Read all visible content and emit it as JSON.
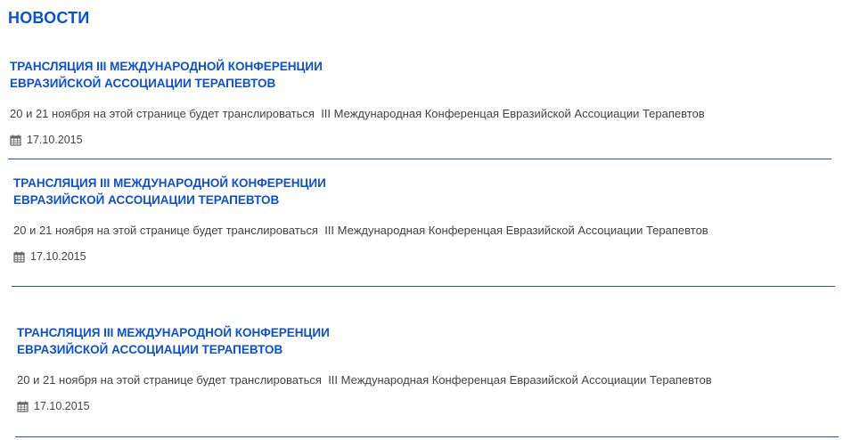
{
  "page": {
    "title": "НОВОСТИ"
  },
  "news": [
    {
      "title": "ТРАНСЛЯЦИЯ III МЕЖДУНАРОДНОЙ КОНФЕРЕНЦИИ\nЕВРАЗИЙСКОЙ АССОЦИАЦИИ ТЕРАПЕВТОВ",
      "description": "20 и 21 ноября на этой странице будет транслироваться  III Международная Конференцая Евразийской Ассоциации Терапевтов",
      "date": "17.10.2015",
      "date_icon": "calendar-icon"
    },
    {
      "title": "ТРАНСЛЯЦИЯ III МЕЖДУНАРОДНОЙ КОНФЕРЕНЦИИ\nЕВРАЗИЙСКОЙ АССОЦИАЦИИ ТЕРАПЕВТОВ",
      "description": "20 и 21 ноября на этой странице будет транслироваться  III Международная Конференцая Евразийской Ассоциации Терапевтов",
      "date": "17.10.2015",
      "date_icon": "calendar-icon"
    },
    {
      "title": "ТРАНСЛЯЦИЯ III МЕЖДУНАРОДНОЙ КОНФЕРЕНЦИИ\nЕВРАЗИЙСКОЙ АССОЦИАЦИИ ТЕРАПЕВТОВ",
      "description": "20 и 21 ноября на этой странице будет транслироваться  III Международная Конференцая Евразийской Ассоциации Терапевтов",
      "date": "17.10.2015",
      "date_icon": "calendar-icon"
    }
  ],
  "colors": {
    "accent": "#0a50d9",
    "text": "#444444",
    "divider": "#1e55b8"
  }
}
